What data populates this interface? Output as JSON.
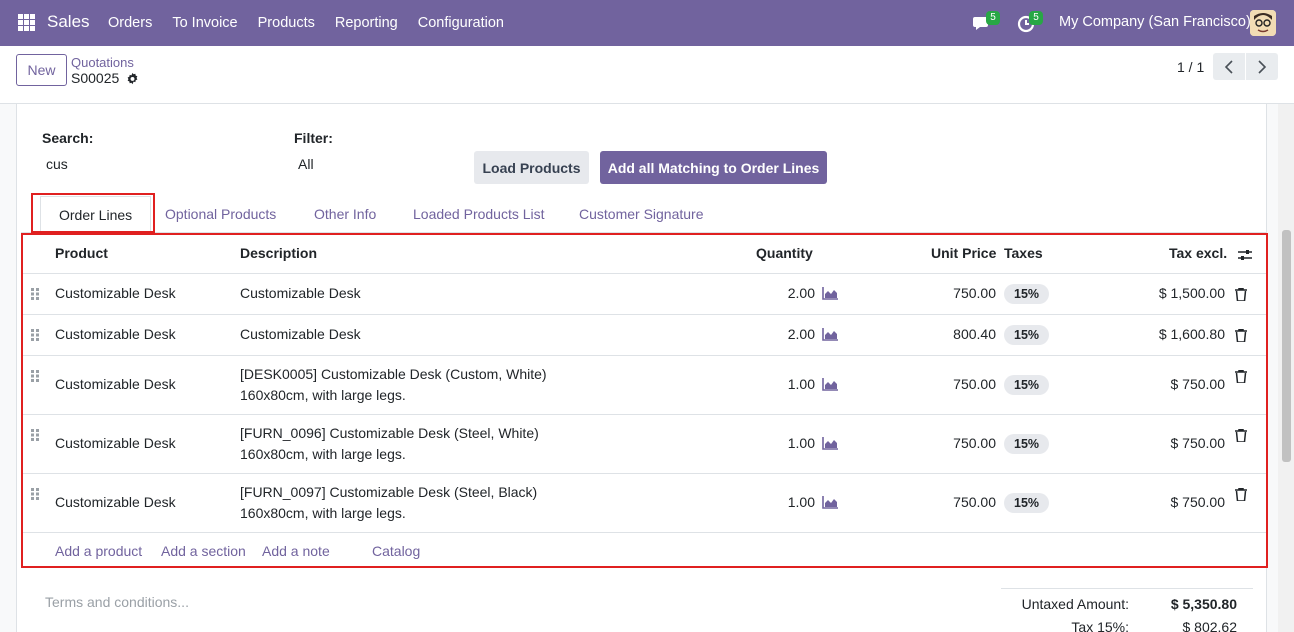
{
  "navbar": {
    "brand": "Sales",
    "menu": [
      "Orders",
      "To Invoice",
      "Products",
      "Reporting",
      "Configuration"
    ],
    "chat_count": "5",
    "activity_count": "5",
    "company": "My Company (San Francisco)"
  },
  "control_panel": {
    "new_label": "New",
    "breadcrumb": "Quotations",
    "record": "S00025",
    "pager": "1 / 1"
  },
  "form": {
    "search_label": "Search:",
    "search_value": "cus",
    "filter_label": "Filter:",
    "filter_value": "All",
    "load_button": "Load Products",
    "add_all_button": "Add all Matching to Order Lines"
  },
  "tabs": [
    "Order Lines",
    "Optional Products",
    "Other Info",
    "Loaded Products List",
    "Customer Signature"
  ],
  "table": {
    "headers": {
      "product": "Product",
      "description": "Description",
      "quantity": "Quantity",
      "unit_price": "Unit Price",
      "taxes": "Taxes",
      "subtotal": "Tax excl."
    },
    "rows": [
      {
        "product": "Customizable Desk",
        "description_1": "Customizable Desk",
        "description_2": "",
        "quantity": "2.00",
        "unit_price": "750.00",
        "tax": "15%",
        "subtotal": "$ 1,500.00"
      },
      {
        "product": "Customizable Desk",
        "description_1": "Customizable Desk",
        "description_2": "",
        "quantity": "2.00",
        "unit_price": "800.40",
        "tax": "15%",
        "subtotal": "$ 1,600.80"
      },
      {
        "product": "Customizable Desk",
        "description_1": "[DESK0005] Customizable Desk (Custom, White)",
        "description_2": "160x80cm, with large legs.",
        "quantity": "1.00",
        "unit_price": "750.00",
        "tax": "15%",
        "subtotal": "$ 750.00"
      },
      {
        "product": "Customizable Desk",
        "description_1": "[FURN_0096] Customizable Desk (Steel, White)",
        "description_2": "160x80cm, with large legs.",
        "quantity": "1.00",
        "unit_price": "750.00",
        "tax": "15%",
        "subtotal": "$ 750.00"
      },
      {
        "product": "Customizable Desk",
        "description_1": "[FURN_0097] Customizable Desk (Steel, Black)",
        "description_2": "160x80cm, with large legs.",
        "quantity": "1.00",
        "unit_price": "750.00",
        "tax": "15%",
        "subtotal": "$ 750.00"
      }
    ],
    "add_links": [
      "Add a product",
      "Add a section",
      "Add a note",
      "Catalog"
    ]
  },
  "footer": {
    "terms_placeholder": "Terms and conditions...",
    "untaxed_label": "Untaxed Amount:",
    "untaxed_value": "$ 5,350.80",
    "tax_label": "Tax 15%:",
    "tax_value": "$ 802.62"
  },
  "colors": {
    "brand": "#71639e",
    "highlight": "#e02020"
  }
}
